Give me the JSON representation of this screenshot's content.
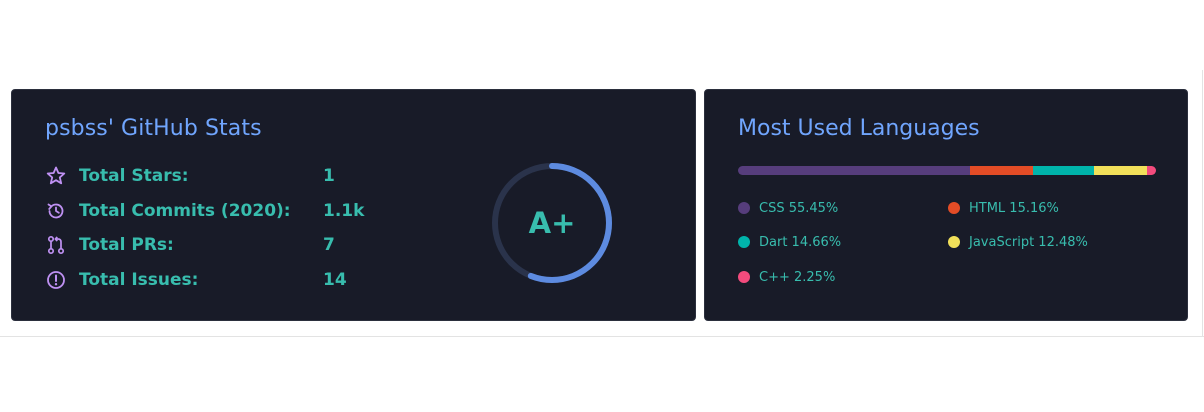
{
  "stats_card": {
    "title": "psbss' GitHub Stats",
    "title_color": "#70a5fd",
    "accent_color": "#38bdae",
    "icon_color": "#bf91f3",
    "stats": [
      {
        "icon": "star-icon",
        "label": "Total Stars:",
        "value": "1"
      },
      {
        "icon": "history-icon",
        "label": "Total Commits (2020):",
        "value": "1.1k"
      },
      {
        "icon": "pull-request-icon",
        "label": "Total PRs:",
        "value": "7"
      },
      {
        "icon": "issue-icon",
        "label": "Total Issues:",
        "value": "14"
      }
    ],
    "rank": {
      "grade": "A+",
      "progress_fraction": 0.56
    }
  },
  "languages_card": {
    "title": "Most Used Languages",
    "languages": [
      {
        "name": "CSS",
        "percent": "55.45%",
        "value": 55.45,
        "color": "#563d7c"
      },
      {
        "name": "HTML",
        "percent": "15.16%",
        "value": 15.16,
        "color": "#e34c26"
      },
      {
        "name": "Dart",
        "percent": "14.66%",
        "value": 14.66,
        "color": "#00b4ab"
      },
      {
        "name": "JavaScript",
        "percent": "12.48%",
        "value": 12.48,
        "color": "#f1e05a"
      },
      {
        "name": "C++",
        "percent": "2.25%",
        "value": 2.25,
        "color": "#f34b7d"
      }
    ],
    "legend_labels": [
      "CSS 55.45%",
      "HTML 15.16%",
      "Dart 14.66%",
      "JavaScript 12.48%",
      "C++ 2.25%"
    ]
  }
}
